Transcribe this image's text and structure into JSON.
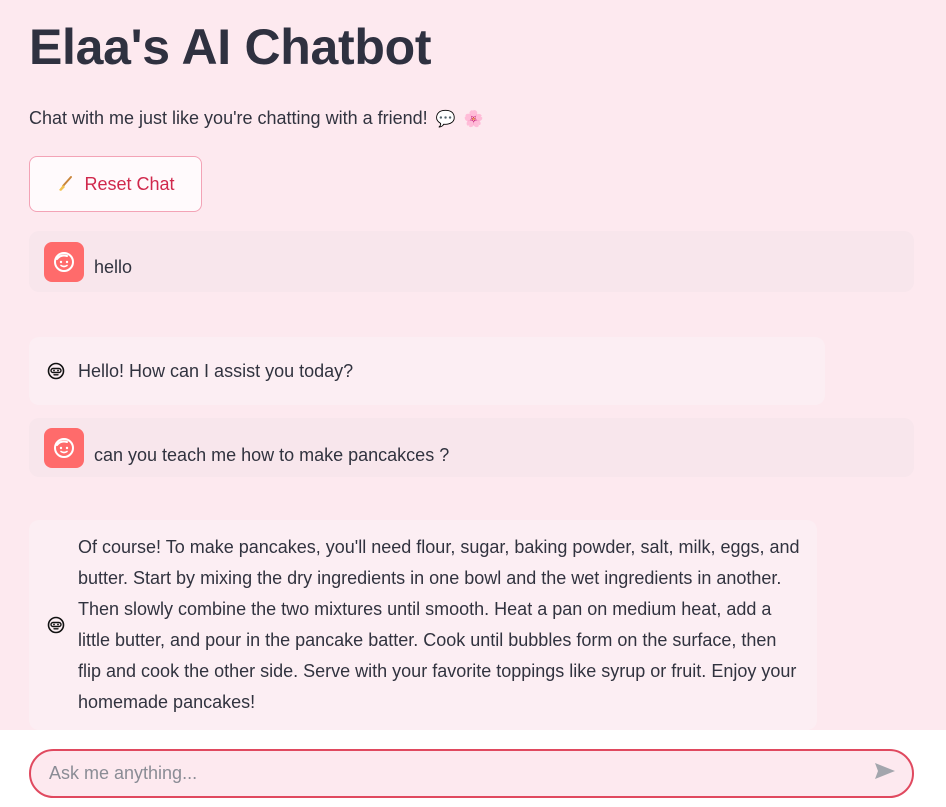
{
  "header": {
    "title": "Elaa's AI Chatbot",
    "subtitle": "Chat with me just like you're chatting with a friend!",
    "subtitle_emojis": [
      "💬",
      "🌸"
    ]
  },
  "toolbar": {
    "reset_label": "Reset Chat",
    "reset_icon": "broom-icon"
  },
  "messages": [
    {
      "role": "user",
      "avatar": "user-face-icon",
      "text": "hello"
    },
    {
      "role": "assistant",
      "avatar": "bot-face-icon",
      "text": "Hello! How can I assist you today?"
    },
    {
      "role": "user",
      "avatar": "user-face-icon",
      "text": "can you teach me how to make pancakces ?"
    },
    {
      "role": "assistant",
      "avatar": "bot-face-icon",
      "text": "Of course! To make pancakes, you'll need flour, sugar, baking powder, salt, milk, eggs, and butter. Start by mixing the dry ingredients in one bowl and the wet ingredients in another. Then slowly combine the two mixtures until smooth. Heat a pan on medium heat, add a little butter, and pour in the pancake batter. Cook until bubbles form on the surface, then flip and cook the other side. Serve with your favorite toppings like syrup or fruit. Enjoy your homemade pancakes!"
    }
  ],
  "chat_input": {
    "placeholder": "Ask me anything...",
    "value": "",
    "send_icon": "send-icon"
  },
  "colors": {
    "background": "#fde9ef",
    "accent": "#e0495f",
    "user_avatar": "#ff6b6b",
    "reset_text": "#d0284c"
  }
}
